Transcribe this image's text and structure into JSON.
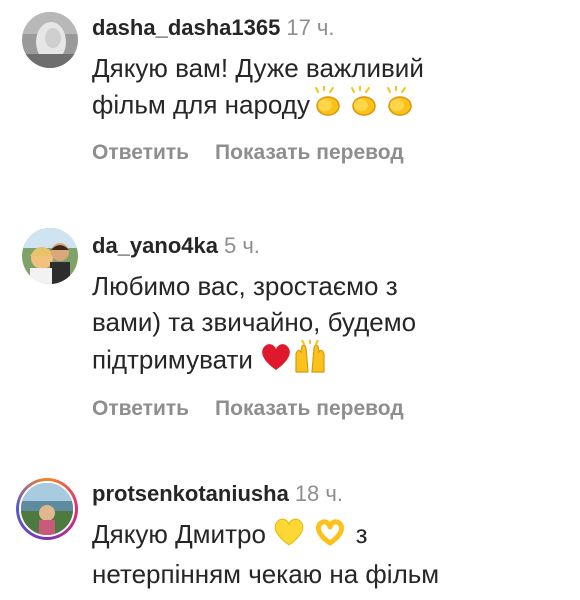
{
  "comments": [
    {
      "username": "dasha_dasha1365",
      "time": "17 ч.",
      "text_line1": "Дякую вам! Дуже важливий",
      "text_line2": "фільм для народу",
      "reply_label": "Ответить",
      "translate_label": "Показать перевод",
      "emojis": [
        "clapping-hands-icon",
        "clapping-hands-icon",
        "clapping-hands-icon"
      ]
    },
    {
      "username": "da_yano4ka",
      "time": "5 ч.",
      "text_line1": "Любимо вас, зростаємо з",
      "text_line2": "вами) та звичайно, будемо",
      "text_line3": "підтримувати",
      "reply_label": "Ответить",
      "translate_label": "Показать перевод",
      "emojis": [
        "red-heart-icon",
        "raising-hands-icon"
      ]
    },
    {
      "username": "protsenkotaniusha",
      "time": "18 ч.",
      "text_line1a": "Дякую Дмитро",
      "text_line1b": "з",
      "text_line2": "нетерпінням чекаю на фільм",
      "emojis": [
        "yellow-heart-icon",
        "heart-hands-icon"
      ]
    }
  ],
  "colors": {
    "text": "#262626",
    "muted": "#8e8e8e"
  }
}
